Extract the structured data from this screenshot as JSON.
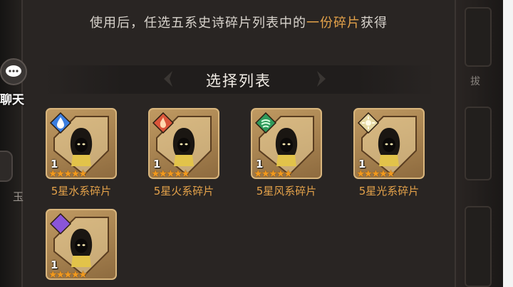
{
  "description": {
    "prefix": "使用后，任选五系史诗碎片列表中的",
    "highlight": "一份碎片",
    "suffix": "获得"
  },
  "section_title": "选择列表",
  "items": [
    {
      "label": "5星水系碎片",
      "count": "1",
      "element": "water-icon",
      "color": "#3b7ee0"
    },
    {
      "label": "5星火系碎片",
      "count": "1",
      "element": "fire-icon",
      "color": "#d9553a"
    },
    {
      "label": "5星风系碎片",
      "count": "1",
      "element": "wind-icon",
      "color": "#2f9a5b"
    },
    {
      "label": "5星光系碎片",
      "count": "1",
      "element": "light-icon",
      "color": "#e6d9a4"
    },
    {
      "label": "",
      "count": "1",
      "element": "dark-icon",
      "color": "#8a55d8"
    }
  ],
  "stars": "★★★★★",
  "side": {
    "chat_label": "聊天",
    "right_partial": "拔",
    "left_partial": "玉"
  }
}
